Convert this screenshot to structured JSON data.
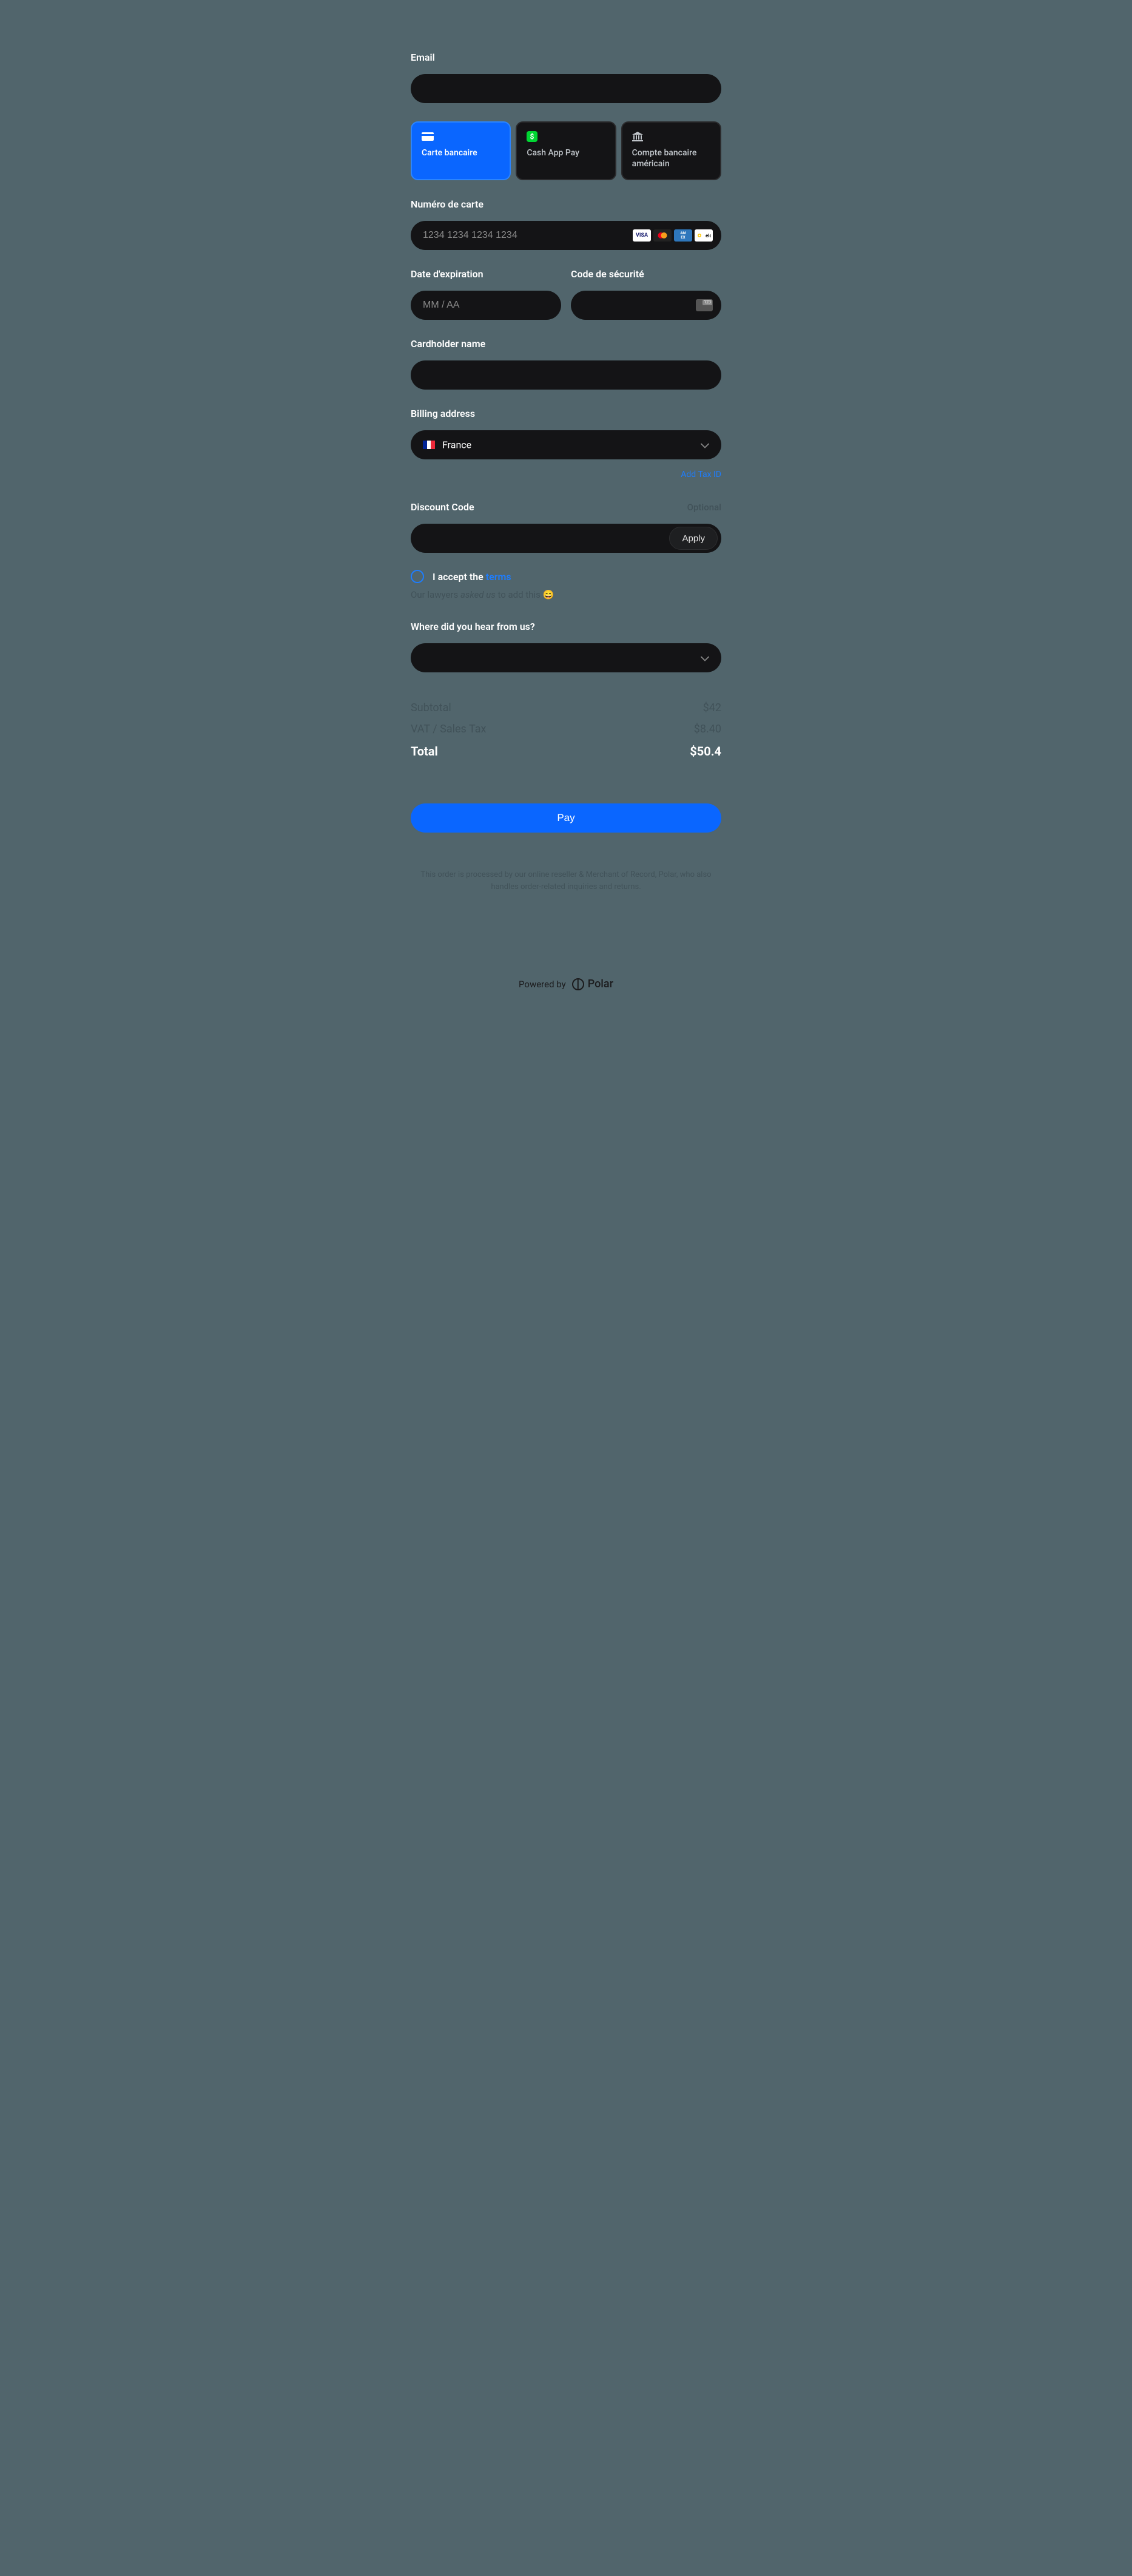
{
  "labels": {
    "email": "Email",
    "cardNumber": "Numéro de carte",
    "expiration": "Date d'expiration",
    "security": "Code de sécurité",
    "cardholder": "Cardholder name",
    "billing": "Billing address",
    "addTaxId": "Add Tax ID",
    "discount": "Discount Code",
    "optional": "Optional",
    "apply": "Apply",
    "termsPrefix": "I accept the ",
    "termsLink": "terms",
    "lawyers_pre": "Our lawyers ",
    "lawyers_em": "asked us",
    "lawyers_post": " to add this 😄",
    "hearFrom": "Where did you hear from us?",
    "pay": "Pay"
  },
  "placeholders": {
    "cardNumber": "1234 1234 1234 1234",
    "expiration": "MM / AA"
  },
  "paymentMethods": {
    "card": "Carte bancaire",
    "cashapp": "Cash App Pay",
    "usbank_line1": "Compte bancaire",
    "usbank_line2": "américain"
  },
  "country": {
    "name": "France"
  },
  "cvcBadge": "123",
  "totals": {
    "subtotalLabel": "Subtotal",
    "subtotalValue": "$42",
    "vatLabel": "VAT / Sales Tax",
    "vatValue": "$8.40",
    "totalLabel": "Total",
    "totalValue": "$50.4"
  },
  "merchantNote": "This order is processed by our online reseller & Merchant of Record, Polar, who also handles order-related inquiries and returns.",
  "poweredBy": "Powered by",
  "brand": "Polar"
}
